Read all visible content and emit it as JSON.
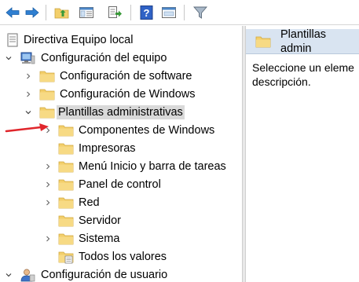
{
  "toolbar": {
    "buttons": [
      {
        "icon": "back-arrow-icon"
      },
      {
        "icon": "forward-arrow-icon"
      },
      {
        "icon": "up-folder-icon"
      },
      {
        "icon": "show-hide-tree-icon"
      },
      {
        "icon": "export-list-icon"
      },
      {
        "icon": "help-icon"
      },
      {
        "icon": "extended-view-icon"
      },
      {
        "icon": "filter-icon"
      }
    ]
  },
  "tree": {
    "root": {
      "label": "Directiva Equipo local"
    },
    "computer_config": {
      "label": "Configuración del equipo"
    },
    "software_settings": {
      "label": "Configuración de software"
    },
    "windows_settings": {
      "label": "Configuración de Windows"
    },
    "admin_templates": {
      "label": "Plantillas administrativas"
    },
    "children": [
      {
        "label": "Componentes de Windows"
      },
      {
        "label": "Impresoras"
      },
      {
        "label": "Menú Inicio y barra de tareas"
      },
      {
        "label": "Panel de control"
      },
      {
        "label": "Red"
      },
      {
        "label": "Servidor"
      },
      {
        "label": "Sistema"
      },
      {
        "label": "Todos los valores"
      }
    ],
    "user_config": {
      "label": "Configuración de usuario"
    }
  },
  "right_pane": {
    "title": "Plantillas admin",
    "description": "Seleccione un eleme descripción."
  },
  "colors": {
    "selection": "#d9d9d9",
    "header": "#d9e4f1",
    "folder": "#f3cf6b",
    "arrow": "#e0262c"
  }
}
